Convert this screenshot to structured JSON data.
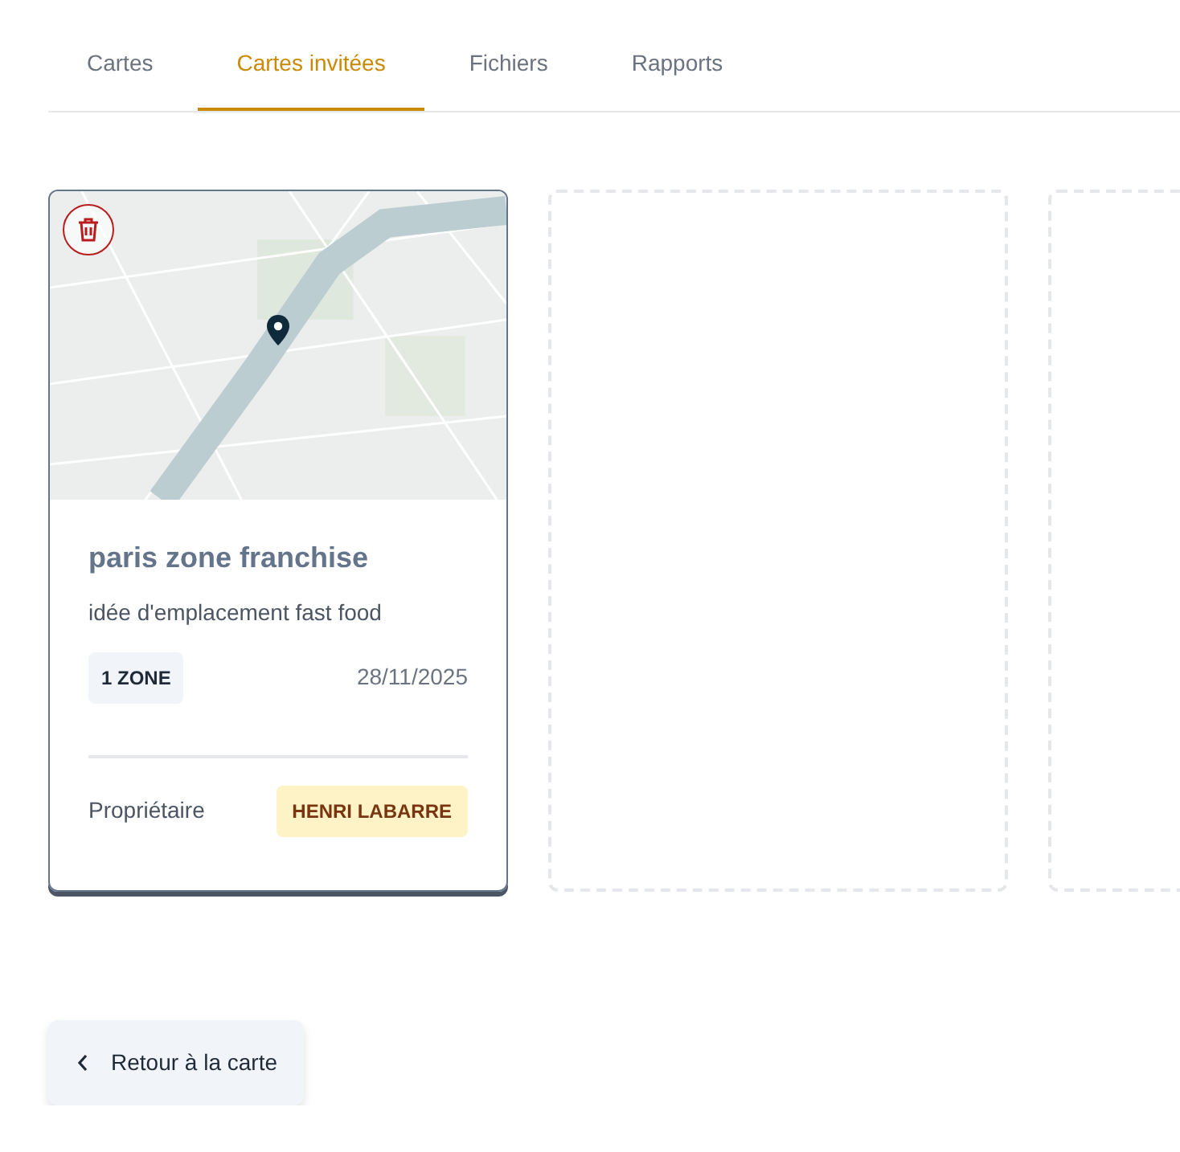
{
  "tabs": [
    {
      "label": "Cartes",
      "selected": false
    },
    {
      "label": "Cartes invitées",
      "selected": true
    },
    {
      "label": "Fichiers",
      "selected": false
    },
    {
      "label": "Rapports",
      "selected": false
    }
  ],
  "cards": [
    {
      "kind": "map",
      "title": "paris zone franchise",
      "description": "idée d'emplacement fast food",
      "zones": "1 ZONE",
      "date": "28/11/2025",
      "owner_label": "Propriétaire",
      "owner": "HENRI LABARRE"
    },
    {
      "kind": "empty"
    },
    {
      "kind": "empty"
    }
  ],
  "back_button": {
    "label": "Retour à la carte"
  }
}
